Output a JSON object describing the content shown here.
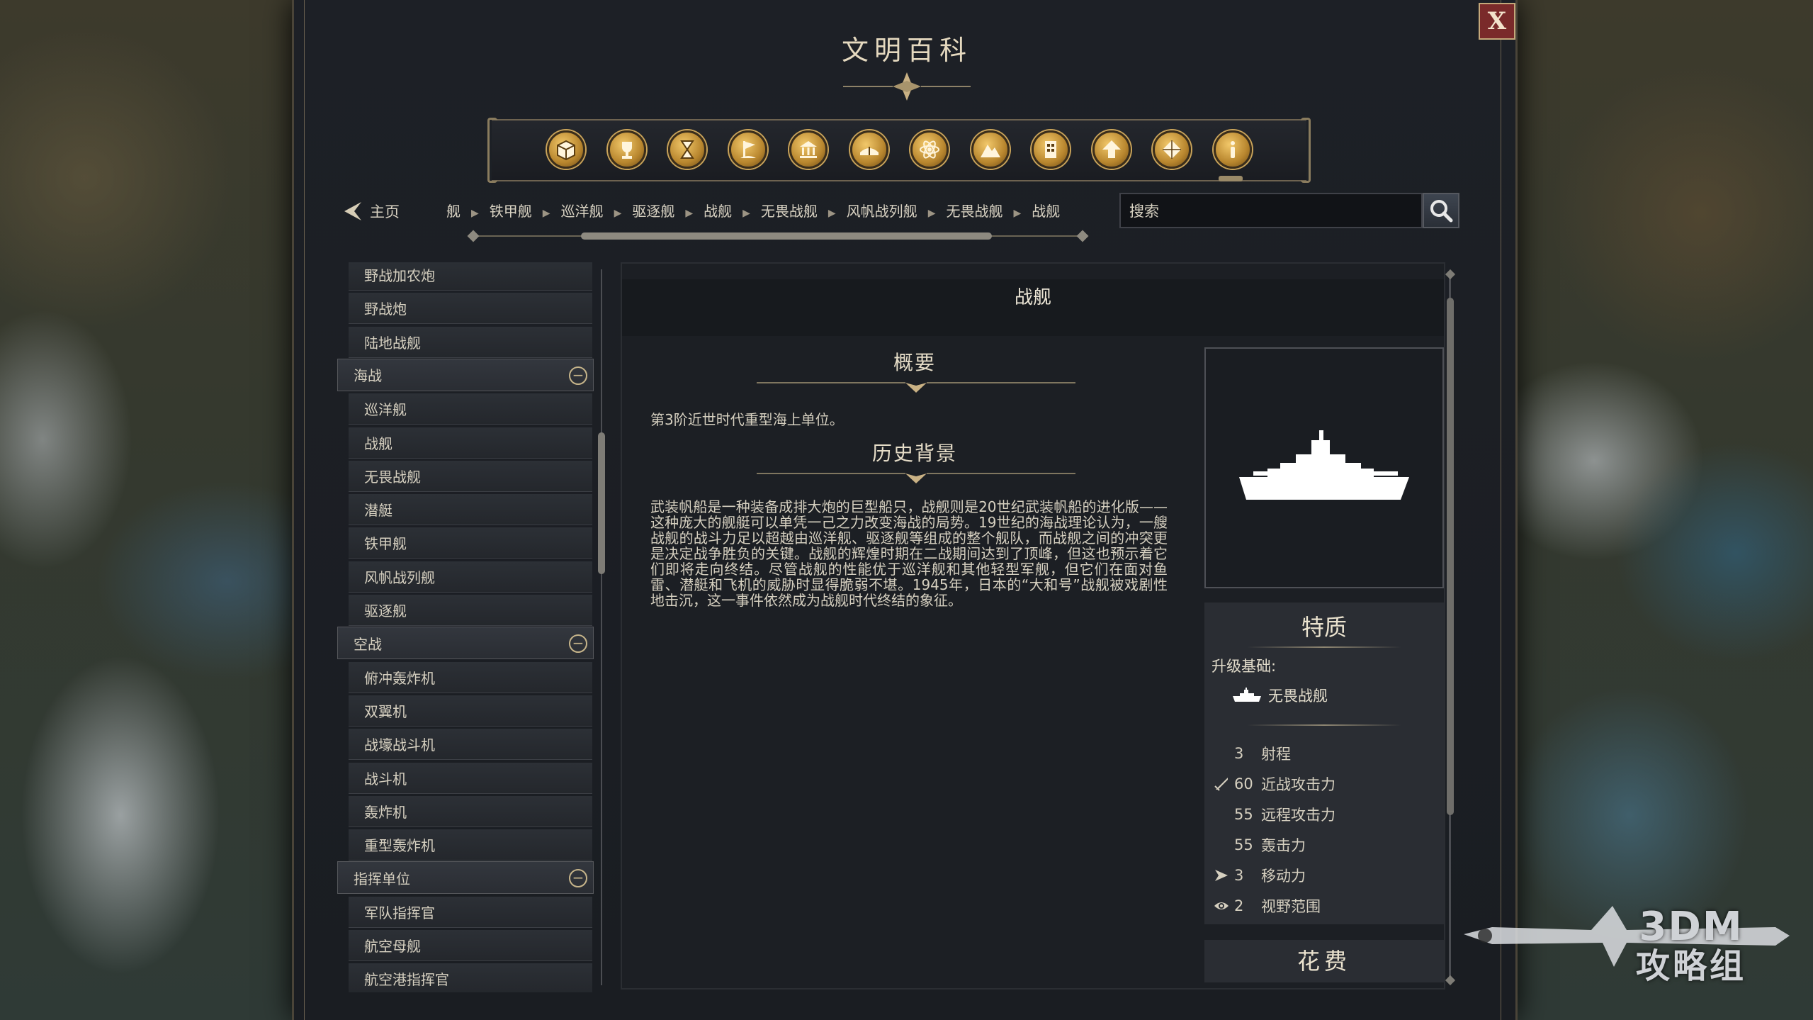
{
  "window": {
    "title": "文明百科",
    "close_label": "X"
  },
  "categories": [
    {
      "icon": "crate-icon"
    },
    {
      "icon": "trophy-icon"
    },
    {
      "icon": "hourglass-icon"
    },
    {
      "icon": "flag-icon"
    },
    {
      "icon": "museum-icon"
    },
    {
      "icon": "book-icon"
    },
    {
      "icon": "atom-icon"
    },
    {
      "icon": "mountain-icon"
    },
    {
      "icon": "building-icon"
    },
    {
      "icon": "upgrade-arrow-icon"
    },
    {
      "icon": "gem-icon"
    },
    {
      "icon": "info-icon"
    }
  ],
  "nav": {
    "home_label": "主页",
    "breadcrumb": [
      "舰",
      "铁甲舰",
      "巡洋舰",
      "驱逐舰",
      "战舰",
      "无畏战舰",
      "风帆战列舰",
      "无畏战舰",
      "战舰"
    ],
    "search_placeholder": "搜索"
  },
  "sidebar": {
    "items_top": [
      "野战加农炮",
      "野战炮",
      "陆地战舰"
    ],
    "groups": [
      {
        "label": "海战",
        "items": [
          "巡洋舰",
          "战舰",
          "无畏战舰",
          "潜艇",
          "铁甲舰",
          "风帆战列舰",
          "驱逐舰"
        ]
      },
      {
        "label": "空战",
        "items": [
          "俯冲轰炸机",
          "双翼机",
          "战壕战斗机",
          "战斗机",
          "轰炸机",
          "重型轰炸机"
        ]
      },
      {
        "label": "指挥单位",
        "items": [
          "军队指挥官",
          "航空母舰",
          "航空港指挥官"
        ]
      }
    ],
    "collapse_symbol": "−"
  },
  "article": {
    "title": "战舰",
    "summary_heading": "概要",
    "summary_text": "第3阶近世时代重型海上单位。",
    "history_heading": "历史背景",
    "history_text": "武装帆船是一种装备成排大炮的巨型船只，战舰则是20世纪武装帆船的进化版——这种庞大的舰艇可以单凭一己之力改变海战的局势。19世纪的海战理论认为，一艘战舰的战斗力足以超越由巡洋舰、驱逐舰等组成的整个舰队，而战舰之间的冲突更是决定战争胜负的关键。战舰的辉煌时期在二战期间达到了顶峰，但这也预示着它们即将走向终结。尽管战舰的性能优于巡洋舰和其他轻型军舰，但它们在面对鱼雷、潜艇和飞机的威胁时显得脆弱不堪。1945年，日本的“大和号”战舰被戏剧性地击沉，这一事件依然成为战舰时代终结的象征。"
  },
  "traits": {
    "heading": "特质",
    "upgrade_label": "升级基础:",
    "upgrade_unit": "无畏战舰",
    "stats": [
      {
        "value": "3",
        "label": "射程",
        "icon": ""
      },
      {
        "value": "60",
        "label": "近战攻击力",
        "icon": "sword-icon"
      },
      {
        "value": "55",
        "label": "远程攻击力",
        "icon": ""
      },
      {
        "value": "55",
        "label": "轰击力",
        "icon": ""
      },
      {
        "value": "3",
        "label": "移动力",
        "icon": "move-arrow-icon"
      },
      {
        "value": "2",
        "label": "视野范围",
        "icon": "eye-icon"
      }
    ],
    "cost_heading": "花费"
  },
  "watermark": {
    "line1": "3DM",
    "line2": "攻略组"
  },
  "colors": {
    "gold": "#c9a24e",
    "panel": "#1d2026",
    "close_red": "#7a2a2a"
  }
}
